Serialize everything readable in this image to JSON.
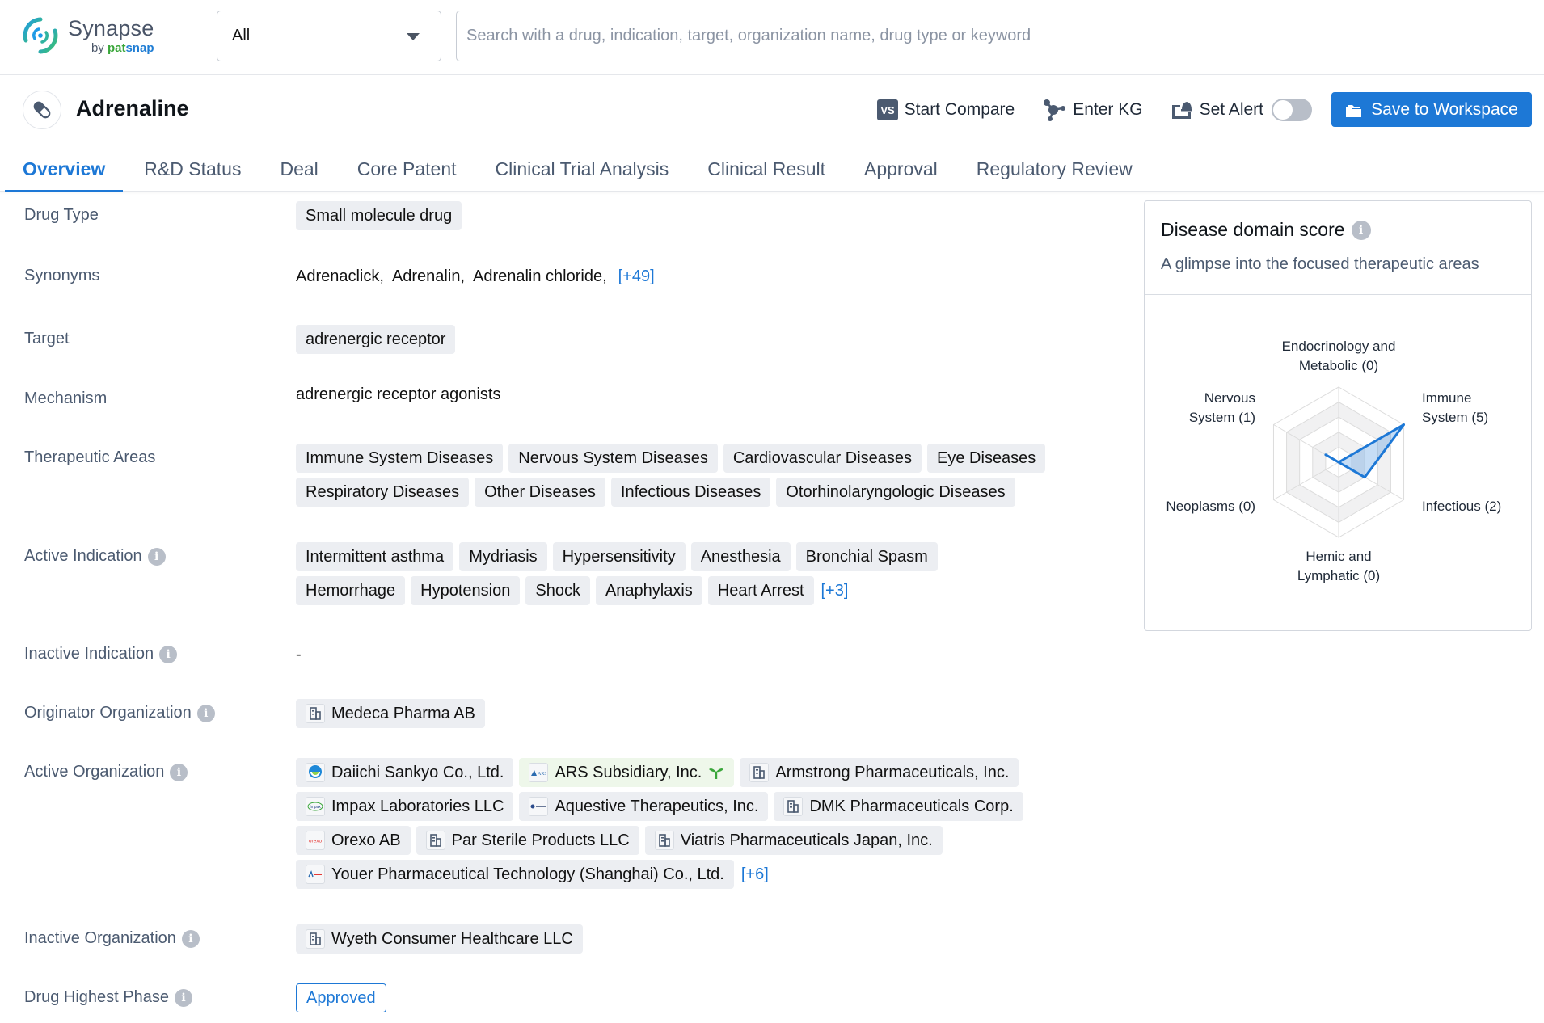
{
  "app": {
    "name": "Synapse",
    "by": "by",
    "brand_part1": "pat",
    "brand_part2": "snap"
  },
  "search": {
    "scope_value": "All",
    "placeholder": "Search with a drug, indication, target, organization name, drug type or keyword",
    "value": ""
  },
  "drug": {
    "title": "Adrenaline",
    "icon": "pill-icon"
  },
  "actions": {
    "compare_badge": "VS",
    "compare_label": "Start Compare",
    "kg_label": "Enter KG",
    "alert_label": "Set Alert",
    "alert_enabled": false,
    "save_label": "Save to Workspace"
  },
  "tabs": [
    {
      "label": "Overview",
      "active": true
    },
    {
      "label": "R&D Status",
      "active": false
    },
    {
      "label": "Deal",
      "active": false
    },
    {
      "label": "Core Patent",
      "active": false
    },
    {
      "label": "Clinical Trial Analysis",
      "active": false
    },
    {
      "label": "Clinical Result",
      "active": false
    },
    {
      "label": "Approval",
      "active": false
    },
    {
      "label": "Regulatory Review",
      "active": false
    }
  ],
  "fields": {
    "drug_type": {
      "label": "Drug Type",
      "value": "Small molecule drug"
    },
    "synonyms": {
      "label": "Synonyms",
      "items": [
        "Adrenaclick,",
        "Adrenalin,",
        "Adrenalin chloride,"
      ],
      "more": "[+49]"
    },
    "target": {
      "label": "Target",
      "value": "adrenergic receptor"
    },
    "mechanism": {
      "label": "Mechanism",
      "value": "adrenergic receptor agonists"
    },
    "therapeutic_areas": {
      "label": "Therapeutic Areas",
      "items": [
        "Immune System Diseases",
        "Nervous System Diseases",
        "Cardiovascular Diseases",
        "Eye Diseases",
        "Respiratory Diseases",
        "Other Diseases",
        "Infectious Diseases",
        "Otorhinolaryngologic Diseases"
      ]
    },
    "active_indication": {
      "label": "Active Indication",
      "items": [
        "Intermittent asthma",
        "Mydriasis",
        "Hypersensitivity",
        "Anesthesia",
        "Bronchial Spasm",
        "Hemorrhage",
        "Hypotension",
        "Shock",
        "Anaphylaxis",
        "Heart Arrest"
      ],
      "more": "[+3]"
    },
    "inactive_indication": {
      "label": "Inactive Indication",
      "value": "-"
    },
    "originator_org": {
      "label": "Originator Organization",
      "items": [
        {
          "name": "Medeca Pharma AB",
          "logo": "building-icon"
        }
      ]
    },
    "active_org": {
      "label": "Active Organization",
      "items": [
        {
          "name": "Daiichi Sankyo Co., Ltd.",
          "logo": "daiichi-logo"
        },
        {
          "name": "ARS Subsidiary, Inc.",
          "logo": "ars-logo",
          "highlight": true,
          "tag": "sprout-icon"
        },
        {
          "name": "Armstrong Pharmaceuticals, Inc.",
          "logo": "building-icon"
        },
        {
          "name": "Impax Laboratories LLC",
          "logo": "impax-logo"
        },
        {
          "name": "Aquestive Therapeutics, Inc.",
          "logo": "aquestive-logo"
        },
        {
          "name": "DMK Pharmaceuticals Corp.",
          "logo": "building-icon"
        },
        {
          "name": "Orexo AB",
          "logo": "orexo-logo"
        },
        {
          "name": "Par Sterile Products LLC",
          "logo": "building-icon"
        },
        {
          "name": "Viatris Pharmaceuticals Japan, Inc.",
          "logo": "building-icon"
        },
        {
          "name": "Youer Pharmaceutical Technology (Shanghai) Co., Ltd.",
          "logo": "youer-logo"
        }
      ],
      "more": "[+6]"
    },
    "inactive_org": {
      "label": "Inactive Organization",
      "items": [
        {
          "name": "Wyeth Consumer Healthcare LLC",
          "logo": "building-icon"
        }
      ]
    },
    "highest_phase": {
      "label": "Drug Highest Phase",
      "value": "Approved"
    }
  },
  "disease_panel": {
    "title": "Disease domain score",
    "subtitle": "A glimpse into the focused therapeutic areas"
  },
  "colors": {
    "accent": "#1d78d6",
    "chip_bg": "#eceef2",
    "highlight_chip_bg": "#eef7ea",
    "label_text": "#4b5a70"
  },
  "chart_data": {
    "type": "radar",
    "title": "Disease domain score",
    "max": 5,
    "rings": 5,
    "axes": [
      {
        "name": "Endocrinology and Metabolic",
        "value": 0,
        "label_lines": [
          "Endocrinology and",
          "Metabolic (0)"
        ]
      },
      {
        "name": "Immune System",
        "value": 5,
        "label_lines": [
          "Immune",
          "System (5)"
        ]
      },
      {
        "name": "Infectious",
        "value": 2,
        "label_lines": [
          "Infectious (2)"
        ]
      },
      {
        "name": "Hemic and Lymphatic",
        "value": 0,
        "label_lines": [
          "Hemic and",
          "Lymphatic (0)"
        ]
      },
      {
        "name": "Neoplasms",
        "value": 0,
        "label_lines": [
          "Neoplasms (0)"
        ]
      },
      {
        "name": "Nervous System",
        "value": 1,
        "label_lines": [
          "Nervous",
          "System (1)"
        ]
      }
    ],
    "series_color": "#1d78d6"
  }
}
